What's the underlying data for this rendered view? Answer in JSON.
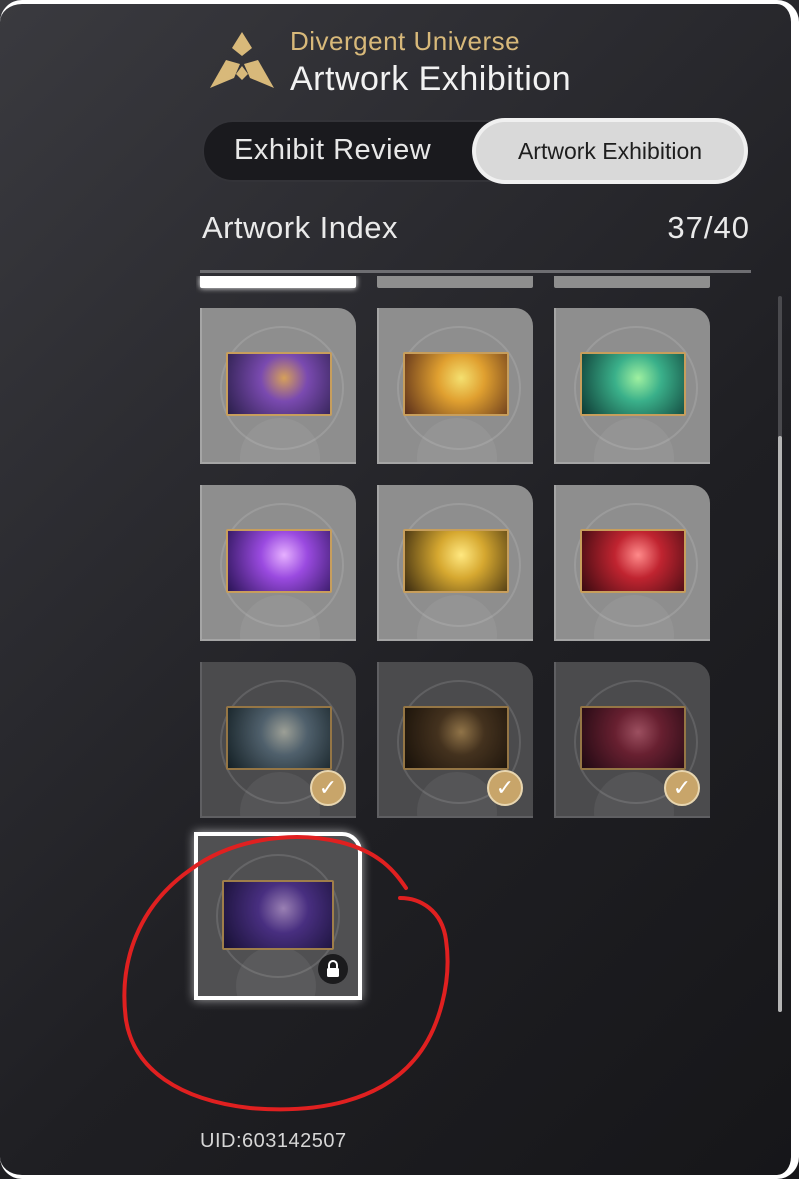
{
  "header": {
    "subtitle": "Divergent Universe",
    "title": "Artwork Exhibition",
    "logo_icon": "diamond-emblem-icon",
    "accent_color": "#d8b97a"
  },
  "tabs": [
    {
      "label": "Exhibit Review",
      "active": false
    },
    {
      "label": "Artwork Exhibition",
      "active": true
    }
  ],
  "index": {
    "title": "Artwork Index",
    "count": "37/40"
  },
  "cards": [
    {
      "state": "available",
      "thumb_colors": [
        "#2a1f4a",
        "#7a4ab0",
        "#d6a05a"
      ]
    },
    {
      "state": "available",
      "thumb_colors": [
        "#5a2e1a",
        "#e0a030",
        "#f4e070"
      ]
    },
    {
      "state": "available",
      "thumb_colors": [
        "#0e3a34",
        "#3ab08a",
        "#9ff0a0"
      ]
    },
    {
      "state": "available",
      "thumb_colors": [
        "#2a1456",
        "#9a4ae0",
        "#e6b0ff"
      ]
    },
    {
      "state": "available",
      "thumb_colors": [
        "#3a2a10",
        "#d6a830",
        "#ffe880"
      ]
    },
    {
      "state": "available",
      "thumb_colors": [
        "#3a0a10",
        "#c02430",
        "#ff8a8a"
      ]
    },
    {
      "state": "collected",
      "thumb_colors": [
        "#1a2a30",
        "#6a8090",
        "#d0d4c8"
      ]
    },
    {
      "state": "collected",
      "thumb_colors": [
        "#20160c",
        "#5a4228",
        "#c09a60"
      ]
    },
    {
      "state": "collected",
      "thumb_colors": [
        "#2a0c18",
        "#8a2a40",
        "#d06a80"
      ]
    },
    {
      "state": "locked",
      "thumb_colors": [
        "#1c1440",
        "#5a3aa0",
        "#c0a0e0"
      ]
    }
  ],
  "icons": {
    "collected": "checkmark-icon",
    "locked": "lock-icon"
  },
  "footer": {
    "uid": "UID:603142507"
  },
  "colors": {
    "annotation": "#e02020",
    "check_badge": "#c8a56a"
  }
}
